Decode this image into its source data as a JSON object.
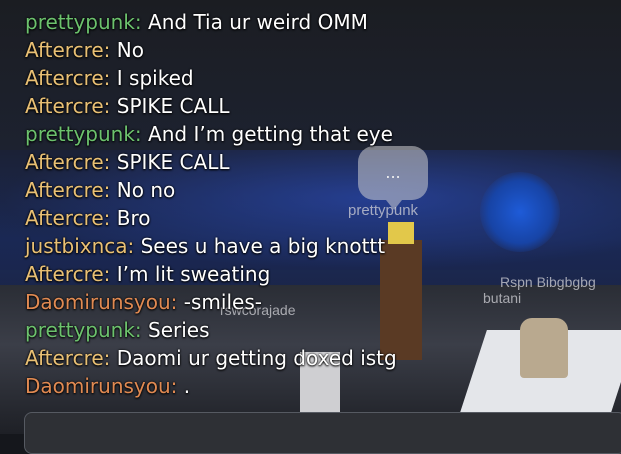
{
  "scene": {
    "bubble_text": "...",
    "nametags": {
      "prettypunk": "prettypunk",
      "rswcorajade": "rswcorajade",
      "rspn": "Rspn Bibgbgbg",
      "butani": "butani"
    }
  },
  "chat": {
    "messages": [
      {
        "speaker": "prettypunk:",
        "text": " And Tia ur weird OMM",
        "color": "#6cc26d"
      },
      {
        "speaker": "Aftercre:",
        "text": " No",
        "color": "#e9c074"
      },
      {
        "speaker": "Aftercre:",
        "text": " I spiked",
        "color": "#e9c074"
      },
      {
        "speaker": "Aftercre:",
        "text": " SPIKE CALL",
        "color": "#e9c074"
      },
      {
        "speaker": "prettypunk:",
        "text": " And I’m getting that eye",
        "color": "#6cc26d"
      },
      {
        "speaker": "Aftercre:",
        "text": " SPIKE CALL",
        "color": "#e9c074"
      },
      {
        "speaker": "Aftercre:",
        "text": " No no",
        "color": "#e9c074"
      },
      {
        "speaker": "Aftercre:",
        "text": " Bro",
        "color": "#e9c074"
      },
      {
        "speaker": "justbixnca:",
        "text": " Sees u have a big knottt",
        "color": "#e9c074"
      },
      {
        "speaker": "Aftercre:",
        "text": " I’m lit sweating",
        "color": "#e9c074"
      },
      {
        "speaker": "Daomirunsyou:",
        "text": " -smiles-",
        "color": "#e18a52"
      },
      {
        "speaker": "prettypunk:",
        "text": " Series",
        "color": "#6cc26d"
      },
      {
        "speaker": "Aftercre:",
        "text": " Daomi ur getting doxed istg",
        "color": "#e9c074"
      },
      {
        "speaker": "Daomirunsyou:",
        "text": " .",
        "color": "#e18a52"
      }
    ]
  }
}
